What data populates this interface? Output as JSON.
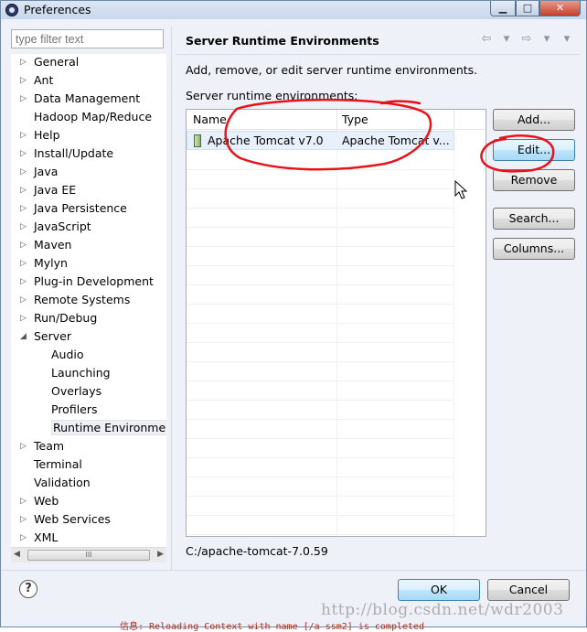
{
  "window": {
    "title": "Preferences",
    "min": "▁",
    "max": "□",
    "close": "✕"
  },
  "filter": {
    "placeholder": "type filter text"
  },
  "tree": [
    {
      "label": "General",
      "arrow": "▷",
      "depth": 0
    },
    {
      "label": "Ant",
      "arrow": "▷",
      "depth": 0
    },
    {
      "label": "Data Management",
      "arrow": "▷",
      "depth": 0
    },
    {
      "label": "Hadoop Map/Reduce",
      "arrow": "",
      "depth": 0
    },
    {
      "label": "Help",
      "arrow": "▷",
      "depth": 0
    },
    {
      "label": "Install/Update",
      "arrow": "▷",
      "depth": 0
    },
    {
      "label": "Java",
      "arrow": "▷",
      "depth": 0
    },
    {
      "label": "Java EE",
      "arrow": "▷",
      "depth": 0
    },
    {
      "label": "Java Persistence",
      "arrow": "▷",
      "depth": 0
    },
    {
      "label": "JavaScript",
      "arrow": "▷",
      "depth": 0
    },
    {
      "label": "Maven",
      "arrow": "▷",
      "depth": 0
    },
    {
      "label": "Mylyn",
      "arrow": "▷",
      "depth": 0
    },
    {
      "label": "Plug-in Development",
      "arrow": "▷",
      "depth": 0
    },
    {
      "label": "Remote Systems",
      "arrow": "▷",
      "depth": 0
    },
    {
      "label": "Run/Debug",
      "arrow": "▷",
      "depth": 0
    },
    {
      "label": "Server",
      "arrow": "◢",
      "depth": 0
    },
    {
      "label": "Audio",
      "arrow": "",
      "depth": 1
    },
    {
      "label": "Launching",
      "arrow": "",
      "depth": 1
    },
    {
      "label": "Overlays",
      "arrow": "",
      "depth": 1
    },
    {
      "label": "Profilers",
      "arrow": "",
      "depth": 1
    },
    {
      "label": "Runtime Environment",
      "arrow": "",
      "depth": 1,
      "selected": true
    },
    {
      "label": "Team",
      "arrow": "▷",
      "depth": 0
    },
    {
      "label": "Terminal",
      "arrow": "",
      "depth": 0
    },
    {
      "label": "Validation",
      "arrow": "",
      "depth": 0
    },
    {
      "label": "Web",
      "arrow": "▷",
      "depth": 0
    },
    {
      "label": "Web Services",
      "arrow": "▷",
      "depth": 0
    },
    {
      "label": "XML",
      "arrow": "▷",
      "depth": 0
    }
  ],
  "scroll": {
    "left": "◀",
    "right": "▶",
    "grip": "III"
  },
  "page": {
    "title": "Server Runtime Environments",
    "nav": [
      "⇦",
      "▾",
      "⇨",
      "▾",
      "▾"
    ],
    "description": "Add, remove, or edit server runtime environments.",
    "table_label": "Server runtime environments:",
    "columns": [
      "Name",
      "Type"
    ],
    "rows": [
      {
        "name": "Apache Tomcat v7.0",
        "type": "Apache Tomcat v..."
      }
    ],
    "path": "C:/apache-tomcat-7.0.59"
  },
  "side_buttons": [
    "Add...",
    "Edit...",
    "Remove",
    "Search...",
    "Columns..."
  ],
  "footer": {
    "help": "?",
    "ok": "OK",
    "cancel": "Cancel"
  },
  "watermark": "http://blog.csdn.net/wdr2003",
  "console_text": "信息: Reloading Context with name [/a ssm2] is completed",
  "colors": {
    "annotation": "#e8121b",
    "accent": "#3c7fb1"
  }
}
